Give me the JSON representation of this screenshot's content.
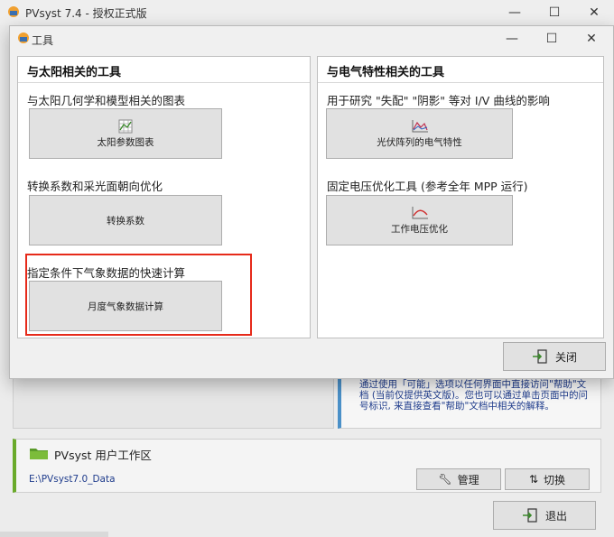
{
  "main_window": {
    "title": "PVsyst 7.4 - 授权正式版",
    "info_text": "通过使用「可能」选项以任何界面中直接访问\"帮助\"文档 (当前仅提供英文版)。您也可以通过单击页面中的问号标识, 来直接查看\"帮助\"文档中相关的解释。",
    "workspace": {
      "title": "PVsyst 用户工作区",
      "path": "E:\\PVsyst7.0_Data",
      "manage_label": "管理",
      "switch_label": "切换"
    },
    "exit_label": "退出"
  },
  "dialog": {
    "title": "工具",
    "solar_panel": {
      "title": "与太阳相关的工具",
      "sections": [
        {
          "label": "与太阳几何学和模型相关的图表",
          "button": "太阳参数图表"
        },
        {
          "label": "转换系数和采光面朝向优化",
          "button": "转换系数"
        },
        {
          "label": "指定条件下气象数据的快速计算",
          "button": "月度气象数据计算"
        }
      ]
    },
    "electrical_panel": {
      "title": "与电气特性相关的工具",
      "sections": [
        {
          "label": "用于研究 \"失配\" \"阴影\" 等对 I/V 曲线的影响",
          "button": "光伏阵列的电气特性"
        },
        {
          "label": "固定电压优化工具 (参考全年 MPP 运行)",
          "button": "工作电压优化"
        }
      ]
    },
    "close_label": "关闭"
  },
  "colors": {
    "highlight": "#e62a1a",
    "info_accent": "#4a90c8",
    "workspace_accent": "#6aaa2a"
  }
}
